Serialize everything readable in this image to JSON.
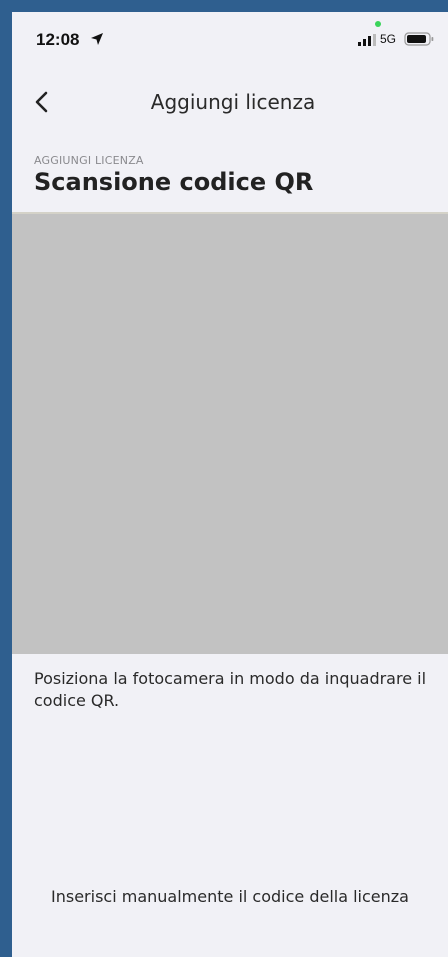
{
  "status_bar": {
    "time": "12:08",
    "network": "5G"
  },
  "nav": {
    "title": "Aggiungi licenza"
  },
  "header": {
    "kicker": "AGGIUNGI LICENZA",
    "title": "Scansione codice QR"
  },
  "camera": {
    "background_color": "#c2c2c2"
  },
  "instructions": "Posiziona la fotocamera in modo da inquadrare il codice QR.",
  "manual_entry_link": "Inserisci manualmente il codice della licenza",
  "icons": {
    "location": "location-arrow-icon",
    "signal": "signal-bars-icon",
    "battery": "battery-icon",
    "back": "chevron-left-icon"
  }
}
